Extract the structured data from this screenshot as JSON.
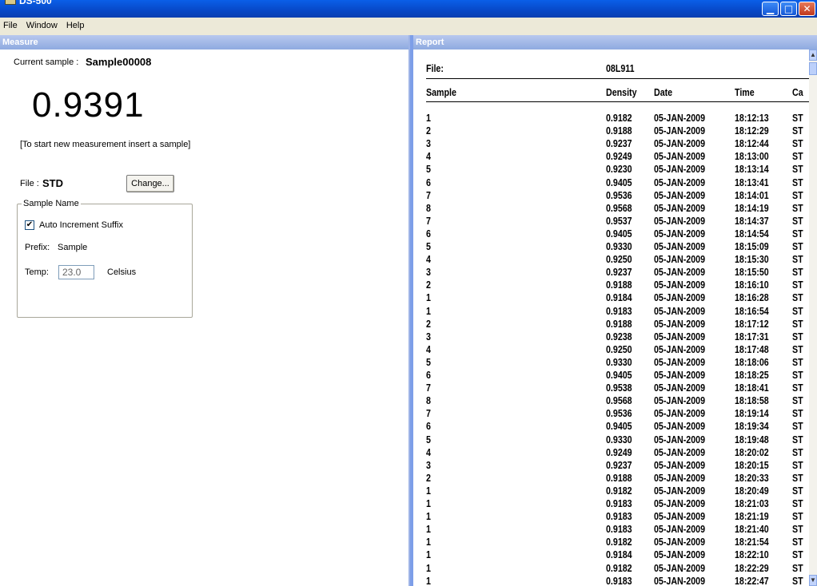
{
  "window": {
    "title": "DS-500"
  },
  "menu": [
    "File",
    "Window",
    "Help"
  ],
  "measure": {
    "header": "Measure",
    "current_sample_label": "Current sample :",
    "current_sample_value": "Sample00008",
    "reading": "0.9391",
    "hint": "[To start new measurement insert a sample]",
    "file_label": "File :",
    "file_value": "STD",
    "change_button": "Change...",
    "group_title": "Sample Name",
    "auto_increment_label": "Auto Increment Suffix",
    "auto_increment_checked": true,
    "prefix_label": "Prefix:",
    "prefix_value": "Sample",
    "temp_label": "Temp:",
    "temp_value": "23.0",
    "temp_unit": "Celsius"
  },
  "report": {
    "header": "Report",
    "file_label": "File:",
    "file_value": "08L911",
    "columns": [
      "Sample",
      "Density",
      "Date",
      "Time",
      "Ca"
    ],
    "rows": [
      [
        "1",
        "0.9182",
        "05-JAN-2009",
        "18:12:13",
        "ST"
      ],
      [
        "2",
        "0.9188",
        "05-JAN-2009",
        "18:12:29",
        "ST"
      ],
      [
        "3",
        "0.9237",
        "05-JAN-2009",
        "18:12:44",
        "ST"
      ],
      [
        "4",
        "0.9249",
        "05-JAN-2009",
        "18:13:00",
        "ST"
      ],
      [
        "5",
        "0.9230",
        "05-JAN-2009",
        "18:13:14",
        "ST"
      ],
      [
        "6",
        "0.9405",
        "05-JAN-2009",
        "18:13:41",
        "ST"
      ],
      [
        "7",
        "0.9536",
        "05-JAN-2009",
        "18:14:01",
        "ST"
      ],
      [
        "8",
        "0.9568",
        "05-JAN-2009",
        "18:14:19",
        "ST"
      ],
      [
        "7",
        "0.9537",
        "05-JAN-2009",
        "18:14:37",
        "ST"
      ],
      [
        "6",
        "0.9405",
        "05-JAN-2009",
        "18:14:54",
        "ST"
      ],
      [
        "5",
        "0.9330",
        "05-JAN-2009",
        "18:15:09",
        "ST"
      ],
      [
        "4",
        "0.9250",
        "05-JAN-2009",
        "18:15:30",
        "ST"
      ],
      [
        "3",
        "0.9237",
        "05-JAN-2009",
        "18:15:50",
        "ST"
      ],
      [
        "2",
        "0.9188",
        "05-JAN-2009",
        "18:16:10",
        "ST"
      ],
      [
        "1",
        "0.9184",
        "05-JAN-2009",
        "18:16:28",
        "ST"
      ],
      [
        "1",
        "0.9183",
        "05-JAN-2009",
        "18:16:54",
        "ST"
      ],
      [
        "2",
        "0.9188",
        "05-JAN-2009",
        "18:17:12",
        "ST"
      ],
      [
        "3",
        "0.9238",
        "05-JAN-2009",
        "18:17:31",
        "ST"
      ],
      [
        "4",
        "0.9250",
        "05-JAN-2009",
        "18:17:48",
        "ST"
      ],
      [
        "5",
        "0.9330",
        "05-JAN-2009",
        "18:18:06",
        "ST"
      ],
      [
        "6",
        "0.9405",
        "05-JAN-2009",
        "18:18:25",
        "ST"
      ],
      [
        "7",
        "0.9538",
        "05-JAN-2009",
        "18:18:41",
        "ST"
      ],
      [
        "8",
        "0.9568",
        "05-JAN-2009",
        "18:18:58",
        "ST"
      ],
      [
        "7",
        "0.9536",
        "05-JAN-2009",
        "18:19:14",
        "ST"
      ],
      [
        "6",
        "0.9405",
        "05-JAN-2009",
        "18:19:34",
        "ST"
      ],
      [
        "5",
        "0.9330",
        "05-JAN-2009",
        "18:19:48",
        "ST"
      ],
      [
        "4",
        "0.9249",
        "05-JAN-2009",
        "18:20:02",
        "ST"
      ],
      [
        "3",
        "0.9237",
        "05-JAN-2009",
        "18:20:15",
        "ST"
      ],
      [
        "2",
        "0.9188",
        "05-JAN-2009",
        "18:20:33",
        "ST"
      ],
      [
        "1",
        "0.9182",
        "05-JAN-2009",
        "18:20:49",
        "ST"
      ],
      [
        "1",
        "0.9183",
        "05-JAN-2009",
        "18:21:03",
        "ST"
      ],
      [
        "1",
        "0.9183",
        "05-JAN-2009",
        "18:21:19",
        "ST"
      ],
      [
        "1",
        "0.9183",
        "05-JAN-2009",
        "18:21:40",
        "ST"
      ],
      [
        "1",
        "0.9182",
        "05-JAN-2009",
        "18:21:54",
        "ST"
      ],
      [
        "1",
        "0.9184",
        "05-JAN-2009",
        "18:22:10",
        "ST"
      ],
      [
        "1",
        "0.9182",
        "05-JAN-2009",
        "18:22:29",
        "ST"
      ],
      [
        "1",
        "0.9183",
        "05-JAN-2009",
        "18:22:47",
        "ST"
      ]
    ]
  },
  "icons": {
    "minimize": "minimize-icon",
    "maximize": "maximize-icon",
    "close": "close-icon",
    "scroll_up": "scroll-up-arrow-icon",
    "scroll_down": "scroll-down-arrow-icon"
  }
}
